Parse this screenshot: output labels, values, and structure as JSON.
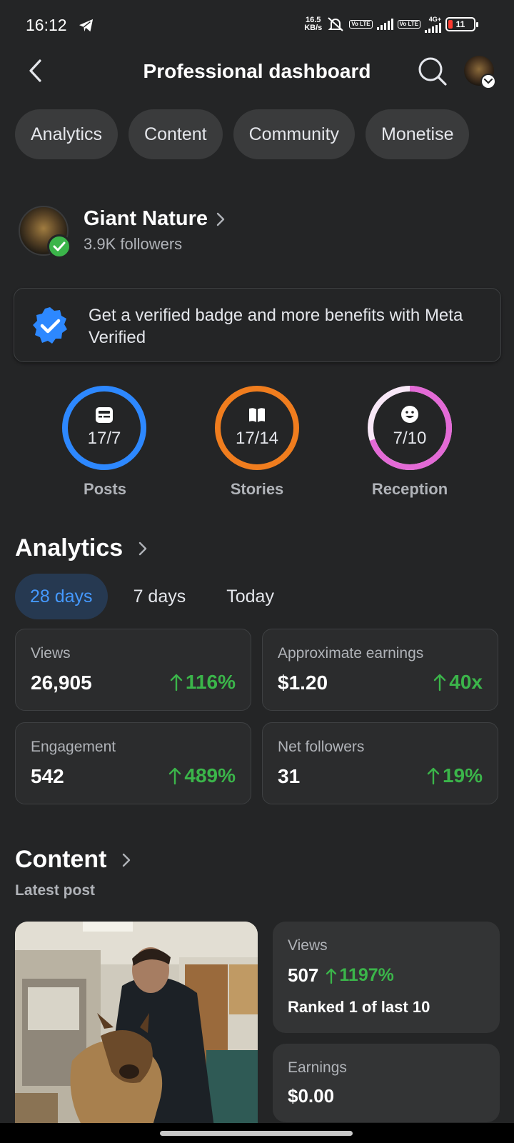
{
  "status_bar": {
    "time": "16:12",
    "net_speed": "16.5",
    "net_unit": "KB/s",
    "sim1": "Vo LTE",
    "sim2": "Vo LTE",
    "network": "4G+",
    "battery": "11"
  },
  "header": {
    "title": "Professional dashboard"
  },
  "chips": [
    "Analytics",
    "Content",
    "Community",
    "Monetise"
  ],
  "page": {
    "name": "Giant Nature",
    "followers": "3.9K followers"
  },
  "meta_verified": {
    "text": "Get a verified badge and more benefits with Meta Verified"
  },
  "goals": [
    {
      "label": "Posts",
      "value": "17/7",
      "progress": 1.0,
      "color": "#2d88ff",
      "icon": "posts-icon"
    },
    {
      "label": "Stories",
      "value": "17/14",
      "progress": 1.0,
      "color": "#f07d1e",
      "icon": "book-icon"
    },
    {
      "label": "Reception",
      "value": "7/10",
      "progress": 0.7,
      "color": "#e36ad6",
      "icon": "smiley-icon"
    }
  ],
  "analytics": {
    "title": "Analytics",
    "tabs": [
      "28 days",
      "7 days",
      "Today"
    ],
    "active_tab": "28 days",
    "stats": [
      {
        "label": "Views",
        "value": "26,905",
        "change": "116%"
      },
      {
        "label": "Approximate earnings",
        "value": "$1.20",
        "change": "40x"
      },
      {
        "label": "Engagement",
        "value": "542",
        "change": "489%"
      },
      {
        "label": "Net followers",
        "value": "31",
        "change": "19%"
      }
    ]
  },
  "content": {
    "title": "Content",
    "latest_label": "Latest post",
    "views_label": "Views",
    "views_value": "507",
    "views_change": "1197%",
    "ranked": "Ranked 1 of last 10",
    "earnings_label": "Earnings",
    "earnings_value": "$0.00"
  },
  "colors": {
    "background": "#242526",
    "accent": "#2d88ff",
    "positive": "#3bb54a"
  }
}
